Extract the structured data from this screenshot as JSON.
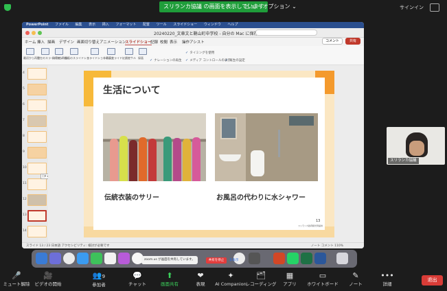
{
  "zoom_top": {
    "share_banner": "スリランカ協議 の画面を表示しています",
    "view_options": "ビュー オプション ⌄",
    "signin": "サインイン"
  },
  "ppt": {
    "menubar": [
      "PowerPoint",
      "ファイル",
      "編集",
      "表示",
      "挿入",
      "フォーマット",
      "配置",
      "ツール",
      "スライドショー",
      "ウィンドウ",
      "ヘルプ"
    ],
    "title": "20240220_文章文と鞘山町中学校 - 自分の Mac に保存済み ⌄",
    "tabs": [
      "ホーム",
      "挿入",
      "描画",
      "デザイン",
      "画面切り替え",
      "アニメーション",
      "スライドショー",
      "記録",
      "校閲",
      "表示",
      "操作アシスト"
    ],
    "comment": "コメント",
    "share": "共有",
    "ribbon_buttons": [
      "最初から再生",
      "現在のスライドから再生",
      "発表者ツール",
      "録画のスライドショー",
      "スライドショーの設定",
      "非表示スライドに設定",
      "リハーサル",
      "録画"
    ],
    "ribbon_checks": [
      "タイミングを使用",
      "ナレーションの再生",
      "メディア コントロールの表示",
      "再生の設定"
    ],
    "thumb_tooltip": "[タイトルなし]",
    "thumb_numbers": [
      "1",
      "2",
      "3",
      "4",
      "5",
      "6",
      "7",
      "8",
      "9",
      "10",
      "11",
      "12",
      "13",
      "14",
      "15"
    ],
    "status_left": "スライド 13 / 23   日本語   アクセシビリティ: 検討が必要です",
    "status_right": "ノート  コメント   110%"
  },
  "slide": {
    "title": "生活について",
    "caption_left": "伝統衣装のサリー",
    "caption_right": "お風呂の代わりに水シャワー",
    "number": "13",
    "footer": "スリランカ政府観光局提供"
  },
  "dock": {
    "share_notice": "zoom.us が画面を共有しています。",
    "stop_share": "共有を停止",
    "hide": "非表示"
  },
  "participant": {
    "name": "スリランカ協議"
  },
  "zoom_toolbar": [
    {
      "icon": "🎤",
      "label": "ミュート解除"
    },
    {
      "icon": "🎥",
      "label": "ビデオの開始"
    },
    {
      "icon": "👥",
      "label": "参加者"
    },
    {
      "icon": "💬",
      "label": "チャット"
    },
    {
      "icon": "⬆",
      "label": "画面共有"
    },
    {
      "icon": "❤",
      "label": "表現"
    },
    {
      "icon": "✦",
      "label": "AI Companion"
    },
    {
      "icon": "🗂",
      "label": "レコーディング"
    },
    {
      "icon": "▦",
      "label": "アプリ"
    },
    {
      "icon": "▭",
      "label": "ホワイトボード"
    },
    {
      "icon": "✎",
      "label": "ノート"
    },
    {
      "icon": "•••",
      "label": "詳細"
    }
  ],
  "participants_count": "9",
  "leave": "退出",
  "colors": {
    "share_green": "#1f9d3a",
    "leave_red": "#d93c37",
    "ppt_blue": "#2b4f8f"
  }
}
